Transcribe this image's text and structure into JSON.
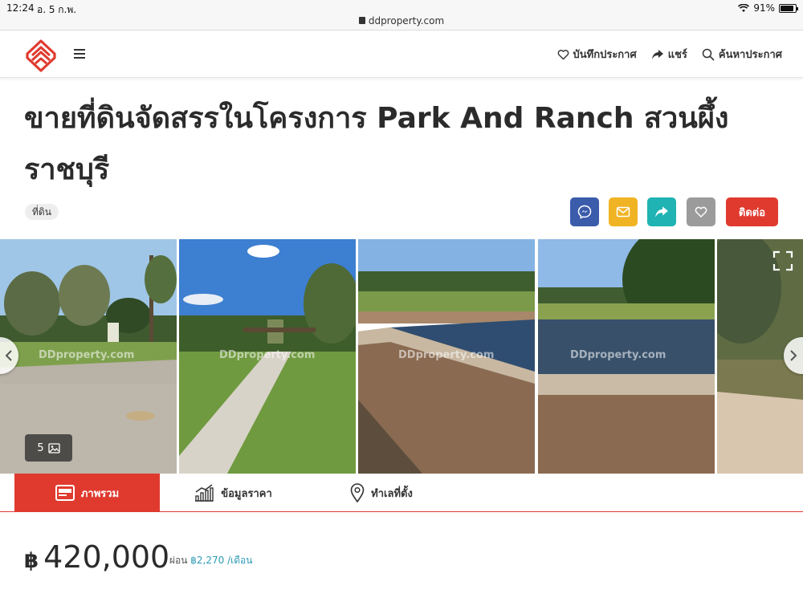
{
  "status_bar": {
    "time": "12:24",
    "date": "อ. 5 ก.พ.",
    "url": "ddproperty.com",
    "battery": "91%"
  },
  "header": {
    "save_label": "บันทึกประกาศ",
    "share_label": "แชร์",
    "search_label": "ค้นหาประกาศ"
  },
  "listing": {
    "title": "ขายที่ดินจัดสรรในโครงการ Park And Ranch สวนผึ้ง ราชบุรี",
    "tag": "ที่ดิน",
    "contact_label": "ติดต่อ",
    "photo_count": "5",
    "watermark": "DDproperty.com"
  },
  "tabs": [
    {
      "label": "ภาพรวม",
      "icon": "overview-icon",
      "active": true
    },
    {
      "label": "ข้อมูลราคา",
      "icon": "price-chart-icon",
      "active": false
    },
    {
      "label": "ทำเลที่ตั้ง",
      "icon": "location-pin-icon",
      "active": false
    }
  ],
  "price": {
    "currency": "฿",
    "amount": "420,000",
    "installment_prefix": "ผ่อน",
    "installment_amount": "฿2,270 /เดือน"
  },
  "colors": {
    "brand_red": "#e03a2f",
    "messenger_blue": "#3b5bab",
    "email_yellow": "#f0b323",
    "share_teal": "#1fb3b3",
    "save_gray": "#9b9b9b"
  }
}
